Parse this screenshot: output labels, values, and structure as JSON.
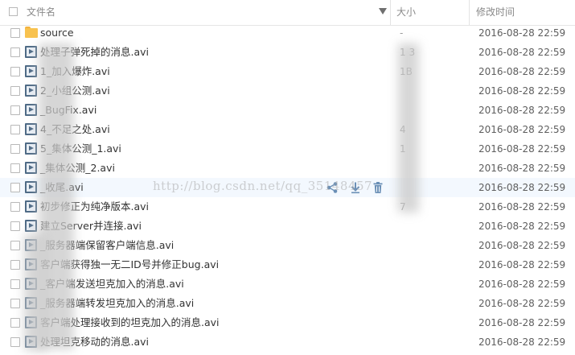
{
  "header": {
    "name_label": "文件名",
    "size_label": "大小",
    "date_label": "修改时间"
  },
  "rows": [
    {
      "type": "folder",
      "name": "source",
      "size": "-",
      "date": "2016-08-28 22:59"
    },
    {
      "type": "video",
      "name": "处理子弹死掉的消息.avi",
      "size": "1   3",
      "date": "2016-08-28 22:59"
    },
    {
      "type": "video",
      "name": "1_加入爆炸.avi",
      "size": "   1B",
      "date": "2016-08-28 22:59"
    },
    {
      "type": "video",
      "name": "2_小组公测.avi",
      "size": "",
      "date": "2016-08-28 22:59"
    },
    {
      "type": "video",
      "name": "_BugFix.avi",
      "size": "",
      "date": "2016-08-28 22:59"
    },
    {
      "type": "video",
      "name": "4_不足之处.avi",
      "size": "4",
      "date": "2016-08-28 22:59"
    },
    {
      "type": "video",
      "name": "5_集体公测_1.avi",
      "size": "1",
      "date": "2016-08-28 22:59"
    },
    {
      "type": "video",
      "name": "_集体公测_2.avi",
      "size": "",
      "date": "2016-08-28 22:59"
    },
    {
      "type": "video",
      "name": "_收尾.avi",
      "size": "",
      "date": "2016-08-28 22:59",
      "hover": true
    },
    {
      "type": "video",
      "name": "初步修正为纯净版本.avi",
      "size": "7",
      "date": "2016-08-28 22:59"
    },
    {
      "type": "video",
      "name": "建立Server并连接.avi",
      "size": "",
      "date": "2016-08-28 22:59"
    },
    {
      "type": "video",
      "name": "_服务器端保留客户端信息.avi",
      "size": "",
      "date": "2016-08-28 22:59"
    },
    {
      "type": "video",
      "name": "客户端获得独一无二ID号并修正bug.avi",
      "size": "",
      "date": "2016-08-28 22:59"
    },
    {
      "type": "video",
      "name": "_客户端发送坦克加入的消息.avi",
      "size": "",
      "date": "2016-08-28 22:59"
    },
    {
      "type": "video",
      "name": "_服务器端转发坦克加入的消息.avi",
      "size": "",
      "date": "2016-08-28 22:59"
    },
    {
      "type": "video",
      "name": "客户端处理接收到的坦克加入的消息.avi",
      "size": "",
      "date": "2016-08-28 22:59"
    },
    {
      "type": "video",
      "name": "处理坦克移动的消息.avi",
      "size": "",
      "date": "2016-08-28 22:59"
    }
  ],
  "watermark": "http://blog.csdn.net/qq_35148457",
  "icons": {
    "folder": "folder-icon",
    "video": "video-file-icon",
    "share": "share-icon",
    "download": "download-icon",
    "delete": "trash-icon",
    "sort": "sort-down-icon"
  },
  "colors": {
    "folder": "#f8c24f",
    "video": "#4f6b86",
    "hover_row": "#f3f8fe",
    "action": "#6a8fb6"
  }
}
